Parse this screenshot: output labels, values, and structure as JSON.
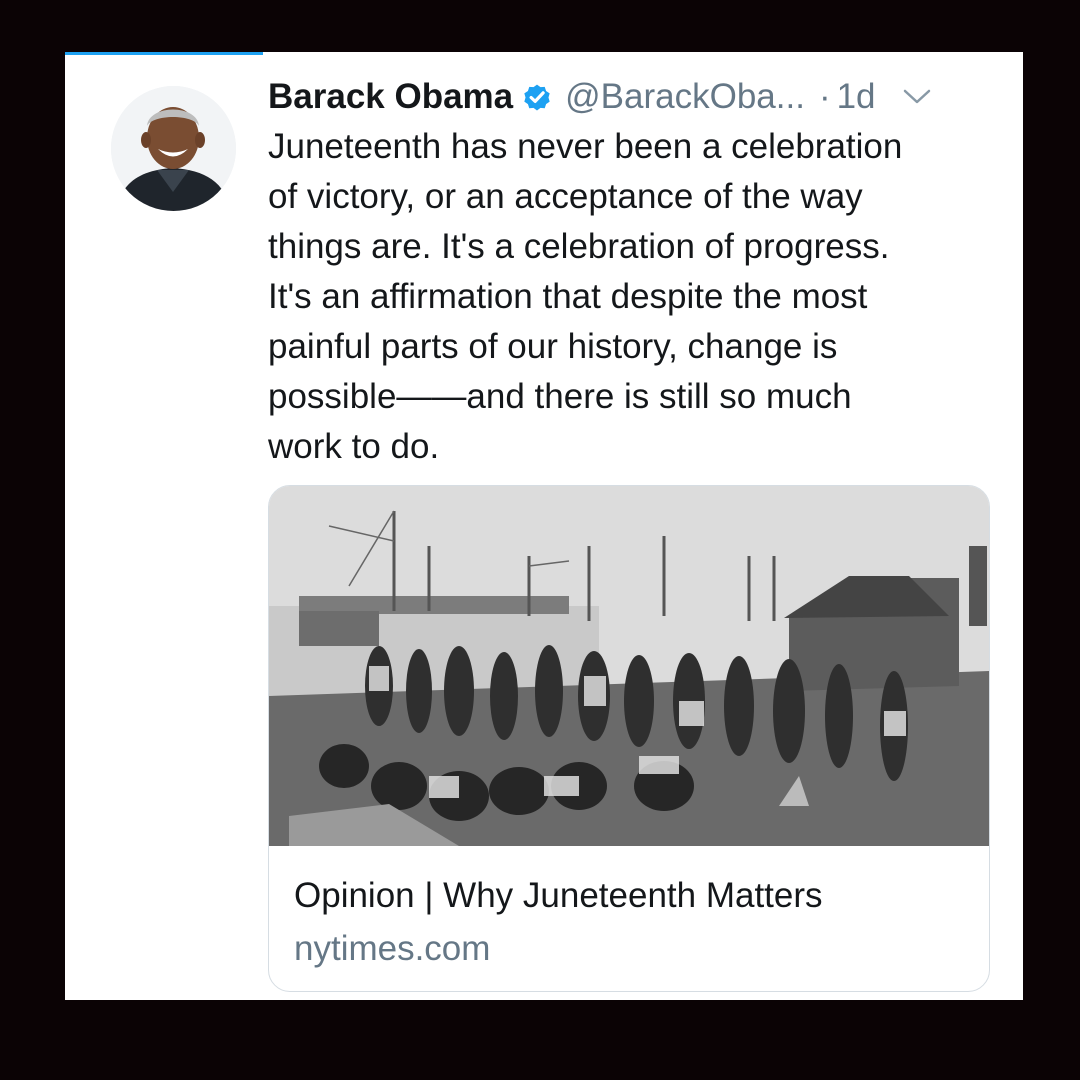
{
  "tweet": {
    "author": {
      "name": "Barack Obama",
      "handle": "@BarackOba...",
      "verified": true
    },
    "separator": "·",
    "timestamp": "1d",
    "text_lines": [
      "Juneteenth has never been a celebration",
      "of victory, or an acceptance of the way",
      "things are. It's a celebration of progress.",
      "It's an affirmation that despite the most",
      "painful parts of our history, change is",
      "possible——and there is still so much",
      "work to do."
    ]
  },
  "link_card": {
    "title": "Opinion | Why Juneteenth Matters",
    "domain": "nytimes.com",
    "image_icon": "historical-photo"
  },
  "icons": {
    "verified": "verified-badge-icon",
    "menu": "chevron-down-icon"
  },
  "colors": {
    "background": "#0b0305",
    "accent": "#1da1f2",
    "primary_text": "#14171a",
    "secondary_text": "#657786",
    "card_border": "#d6dde3"
  }
}
